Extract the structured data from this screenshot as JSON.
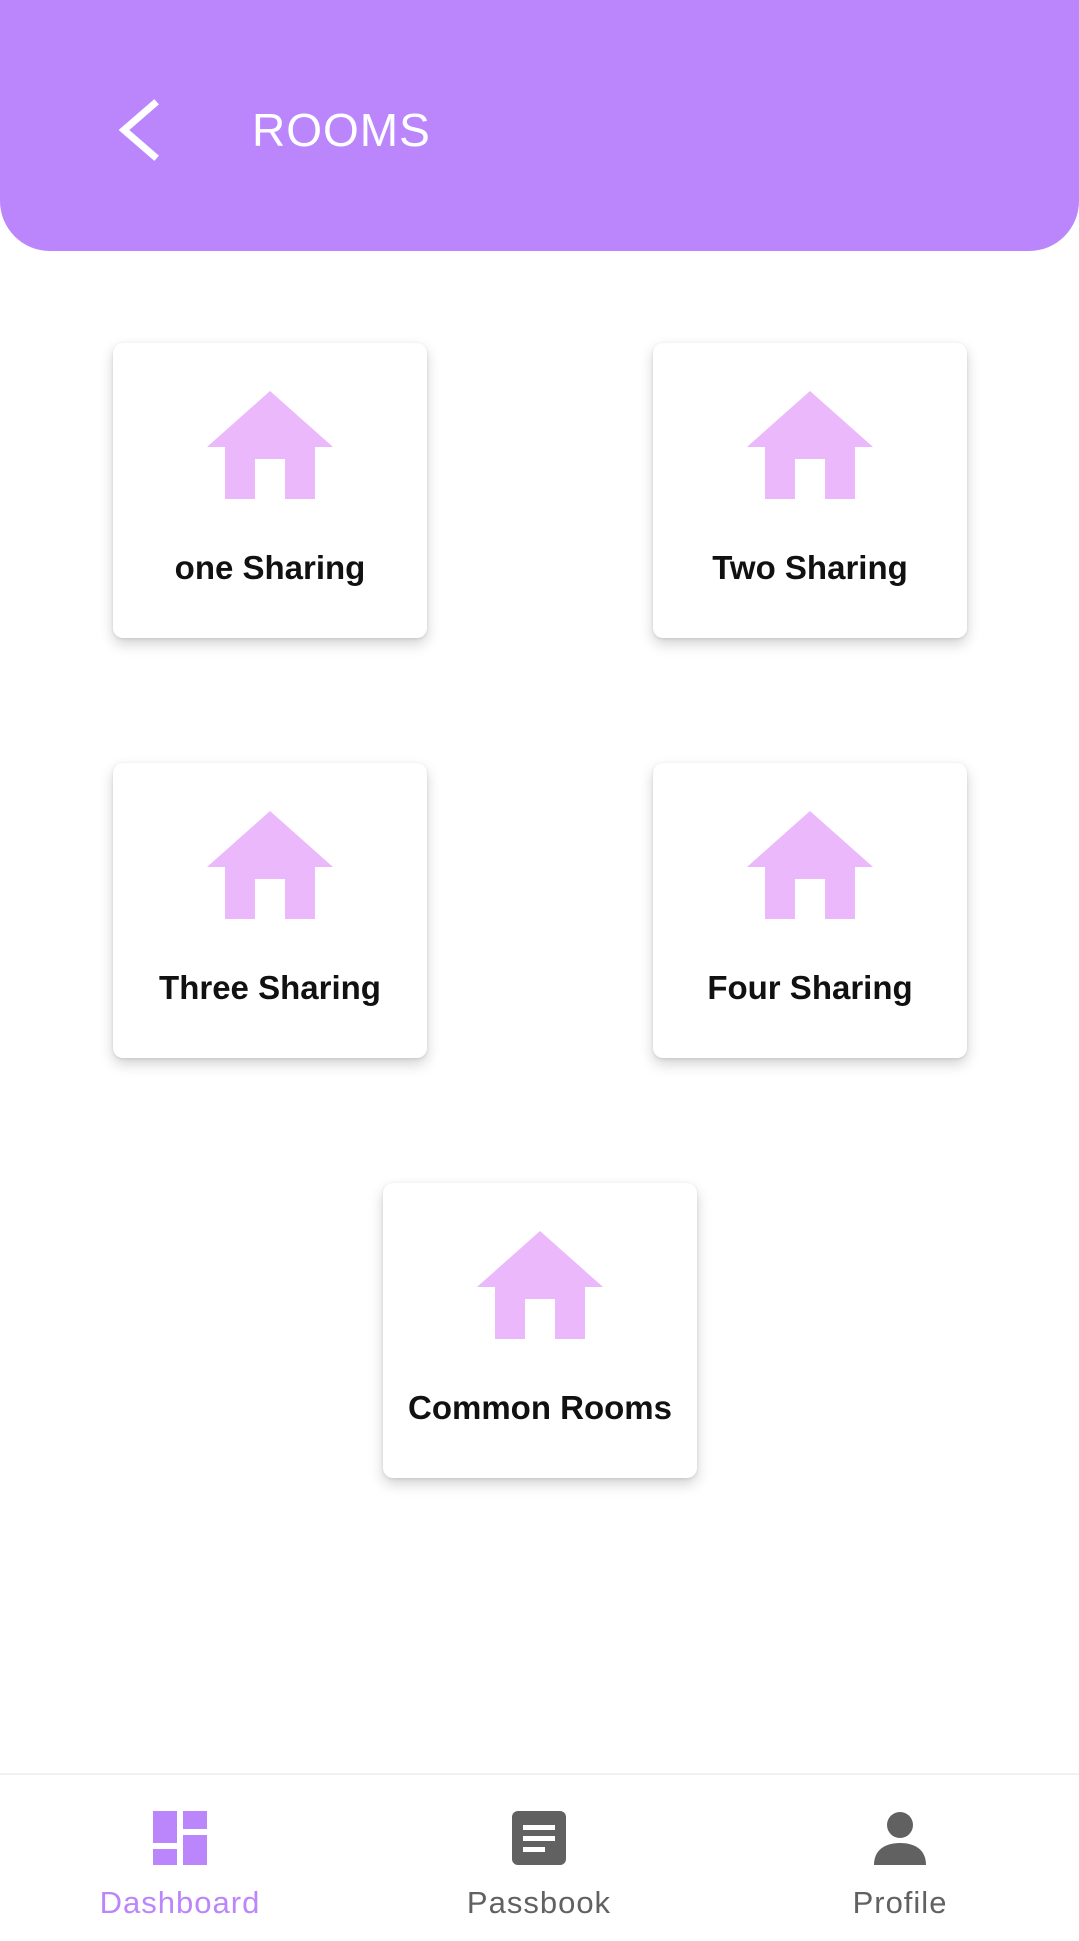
{
  "header": {
    "title": "ROOMS",
    "back_icon": "chevron-left-icon"
  },
  "cards": [
    {
      "label": "one Sharing",
      "icon": "house-icon"
    },
    {
      "label": "Two Sharing",
      "icon": "house-icon"
    },
    {
      "label": "Three Sharing",
      "icon": "house-icon"
    },
    {
      "label": "Four Sharing",
      "icon": "house-icon"
    },
    {
      "label": "Common Rooms",
      "icon": "house-icon"
    }
  ],
  "bottom_nav": {
    "items": [
      {
        "label": "Dashboard",
        "icon": "dashboard-icon",
        "active": true
      },
      {
        "label": "Passbook",
        "icon": "document-icon",
        "active": false
      },
      {
        "label": "Profile",
        "icon": "person-icon",
        "active": false
      }
    ]
  },
  "colors": {
    "accent": "#bb86fc",
    "house_icon": "#eab8fb",
    "inactive_nav": "#616161",
    "card_text": "#111111"
  }
}
